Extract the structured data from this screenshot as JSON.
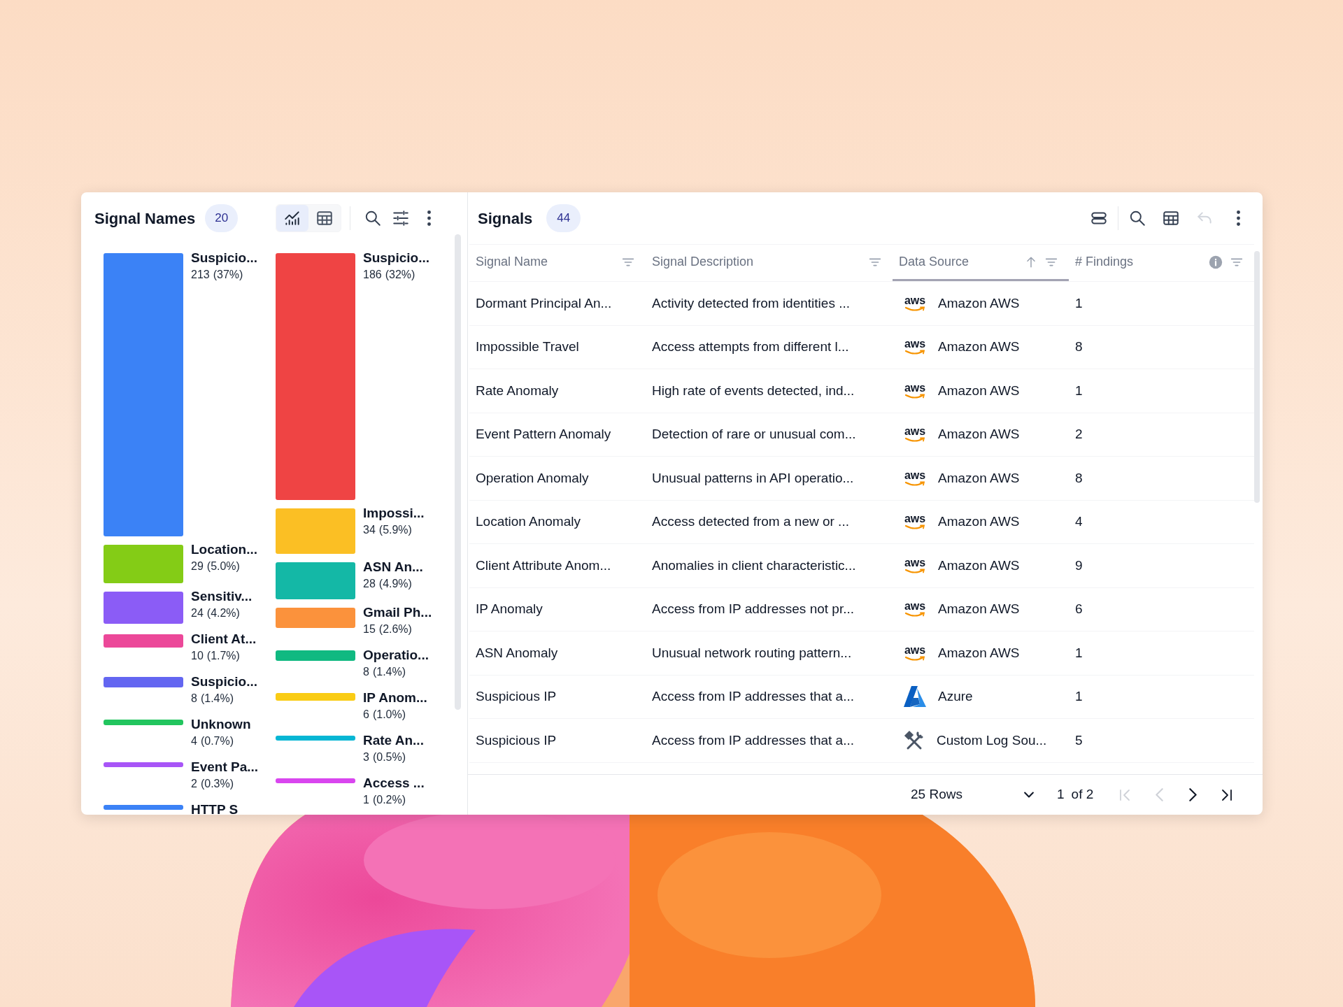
{
  "left_panel": {
    "title": "Signal Names",
    "count": "20",
    "view_toggle": [
      {
        "kind": "chart",
        "selected": true
      },
      {
        "kind": "table",
        "selected": false
      }
    ],
    "toolbar": [
      {
        "kind": "search"
      },
      {
        "kind": "sliders"
      },
      {
        "kind": "more"
      }
    ],
    "columns": [
      [
        {
          "name": "Suspicio...",
          "count": "213",
          "share": "(37%)",
          "color": "#3b82f6"
        },
        {
          "name": "Location...",
          "count": "29",
          "share": "(5.0%)",
          "color": "#84cc16"
        },
        {
          "name": "Sensitiv...",
          "count": "24",
          "share": "(4.2%)",
          "color": "#8b5cf6"
        },
        {
          "name": "Client At...",
          "count": "10",
          "share": "(1.7%)",
          "color": "#ec4899"
        },
        {
          "name": "Suspicio...",
          "count": "8",
          "share": "(1.4%)",
          "color": "#6366f1"
        },
        {
          "name": "Unknown",
          "count": "4",
          "share": "(0.7%)",
          "color": "#22c55e"
        },
        {
          "name": "Event Pa...",
          "count": "2",
          "share": "(0.3%)",
          "color": "#a855f7"
        },
        {
          "name": "HTTP S",
          "color": "#3b82f6"
        }
      ],
      [
        {
          "name": "Suspicio...",
          "count": "186",
          "share": "(32%)",
          "color": "#ef4444"
        },
        {
          "name": "Impossi...",
          "count": "34",
          "share": "(5.9%)",
          "color": "#fbbf24"
        },
        {
          "name": "ASN An...",
          "count": "28",
          "share": "(4.9%)",
          "color": "#14b8a6"
        },
        {
          "name": "Gmail Ph...",
          "count": "15",
          "share": "(2.6%)",
          "color": "#fb923c"
        },
        {
          "name": "Operatio...",
          "count": "8",
          "share": "(1.4%)",
          "color": "#10b981"
        },
        {
          "name": "IP Anom...",
          "count": "6",
          "share": "(1.0%)",
          "color": "#facc15"
        },
        {
          "name": "Rate An...",
          "count": "3",
          "share": "(0.5%)",
          "color": "#06b6d4"
        },
        {
          "name": "Access ...",
          "count": "1",
          "share": "(0.2%)",
          "color": "#d946ef"
        }
      ]
    ]
  },
  "right_panel": {
    "title": "Signals",
    "count": "44",
    "toolbar": [
      {
        "kind": "rows",
        "disabled": false
      },
      {
        "kind": "search",
        "disabled": false
      },
      {
        "kind": "table",
        "disabled": false
      },
      {
        "kind": "undo",
        "disabled": true
      },
      {
        "kind": "more",
        "disabled": false
      }
    ],
    "table": {
      "columns": [
        {
          "label": "Signal Name",
          "sorted": false,
          "info": false
        },
        {
          "label": "Signal Description",
          "sorted": false,
          "info": false
        },
        {
          "label": "Data Source",
          "sorted": true,
          "info": false
        },
        {
          "label": "# Findings",
          "sorted": false,
          "info": true
        }
      ],
      "rows": [
        {
          "signal_name": "Dormant Principal An...",
          "description": "Activity detected from identities ...",
          "source": {
            "kind": "aws",
            "logo_text": "aws",
            "name": "Amazon AWS"
          },
          "findings": "1"
        },
        {
          "signal_name": "Impossible Travel",
          "description": "Access attempts from different l...",
          "source": {
            "kind": "aws",
            "logo_text": "aws",
            "name": "Amazon AWS"
          },
          "findings": "8"
        },
        {
          "signal_name": "Rate Anomaly",
          "description": "High rate of events detected, ind...",
          "source": {
            "kind": "aws",
            "logo_text": "aws",
            "name": "Amazon AWS"
          },
          "findings": "1"
        },
        {
          "signal_name": "Event Pattern Anomaly",
          "description": "Detection of rare or unusual com...",
          "source": {
            "kind": "aws",
            "logo_text": "aws",
            "name": "Amazon AWS"
          },
          "findings": "2"
        },
        {
          "signal_name": "Operation Anomaly",
          "description": "Unusual patterns in API operatio...",
          "source": {
            "kind": "aws",
            "logo_text": "aws",
            "name": "Amazon AWS"
          },
          "findings": "8"
        },
        {
          "signal_name": "Location Anomaly",
          "description": "Access detected from a new or ...",
          "source": {
            "kind": "aws",
            "logo_text": "aws",
            "name": "Amazon AWS"
          },
          "findings": "4"
        },
        {
          "signal_name": "Client Attribute Anom...",
          "description": "Anomalies in client characteristic...",
          "source": {
            "kind": "aws",
            "logo_text": "aws",
            "name": "Amazon AWS"
          },
          "findings": "9"
        },
        {
          "signal_name": "IP Anomaly",
          "description": "Access from IP addresses not pr...",
          "source": {
            "kind": "aws",
            "logo_text": "aws",
            "name": "Amazon AWS"
          },
          "findings": "6"
        },
        {
          "signal_name": "ASN Anomaly",
          "description": "Unusual network routing pattern...",
          "source": {
            "kind": "aws",
            "logo_text": "aws",
            "name": "Amazon AWS"
          },
          "findings": "1"
        },
        {
          "signal_name": "Suspicious IP",
          "description": "Access from IP addresses that a...",
          "source": {
            "kind": "azure",
            "name": "Azure"
          },
          "findings": "1"
        },
        {
          "signal_name": "Suspicious IP",
          "description": "Access from IP addresses that a...",
          "source": {
            "kind": "tools",
            "name": "Custom Log Sou..."
          },
          "findings": "5"
        }
      ]
    },
    "footer": {
      "rows_per_page": "25 Rows",
      "page": "1",
      "page_total": "of 2",
      "pager": [
        {
          "kind": "first",
          "disabled": true
        },
        {
          "kind": "prev",
          "disabled": true
        },
        {
          "kind": "next",
          "disabled": false
        },
        {
          "kind": "last",
          "disabled": false
        }
      ]
    }
  }
}
